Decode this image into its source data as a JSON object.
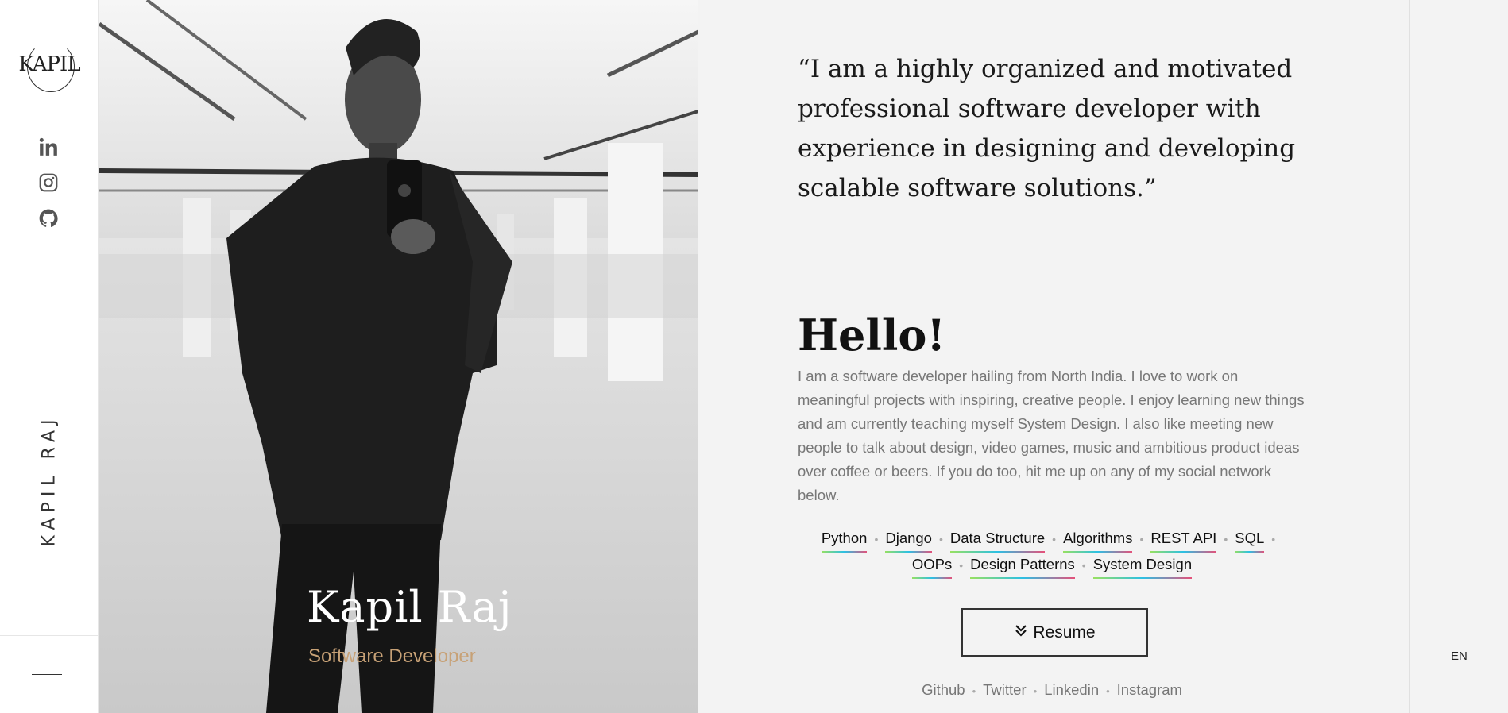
{
  "sidebar": {
    "logo_text": "KAPIL",
    "social": [
      {
        "name": "linkedin-icon"
      },
      {
        "name": "instagram-icon"
      },
      {
        "name": "github-icon"
      }
    ],
    "vertical_name": "KAPIL RAJ",
    "menu_icon": "hamburger-menu-icon"
  },
  "hero": {
    "name": "Kapil Raj",
    "role": "Software Developer"
  },
  "content": {
    "quote": "“I am a highly organized and motivated professional software developer with experience in designing and developing scalable software solutions.”",
    "greeting": "Hello!",
    "about": "I am a software developer hailing from North India. I love to work on meaningful projects with inspiring, creative people. I enjoy learning new things and am currently teaching myself System Design. I also like meeting new people to talk about design, video games, music and ambitious product ideas over coffee or beers. If you do too, hit me up on any of my social network below.",
    "skills": [
      "Python",
      "Django",
      "Data Structure",
      "Algorithms",
      "REST API",
      "SQL",
      "OOPs",
      "Design Patterns",
      "System Design"
    ],
    "resume_label": "Resume",
    "links": [
      "Github",
      "Twitter",
      "Linkedin",
      "Instagram"
    ]
  },
  "language": "EN",
  "colors": {
    "accent_gold": "#c7a176",
    "skill_underline": [
      "#9be15d",
      "#2bc0e4",
      "#e94e77"
    ]
  }
}
